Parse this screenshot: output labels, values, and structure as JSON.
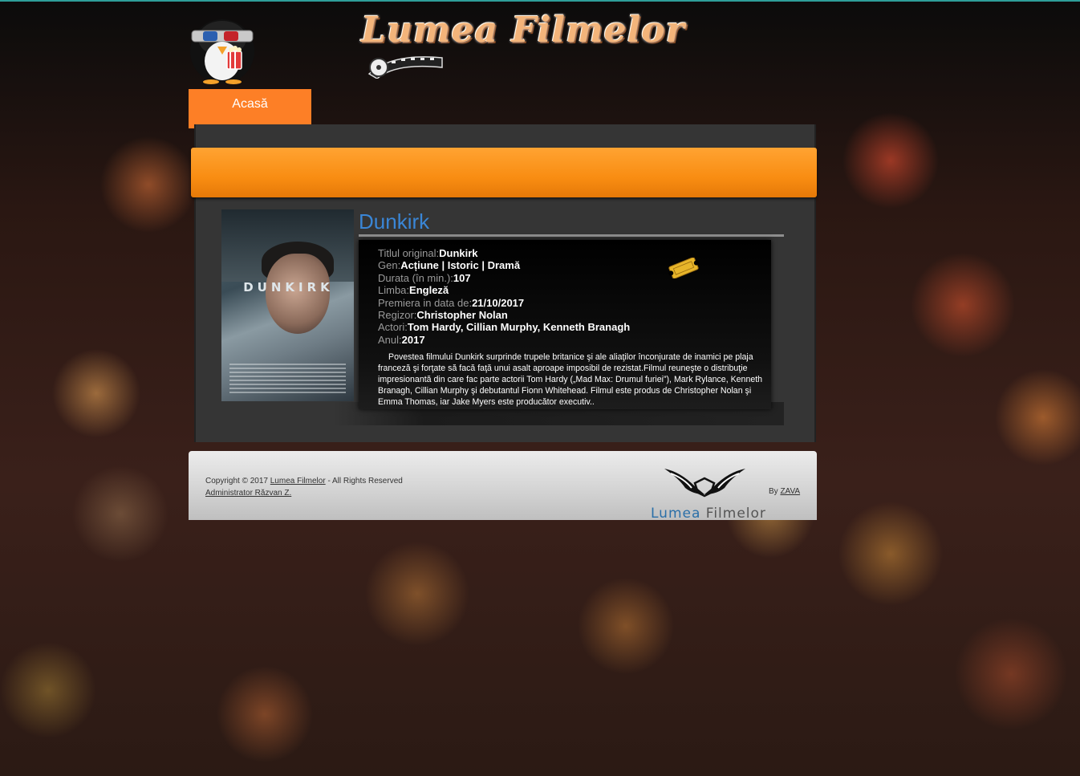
{
  "header": {
    "site_title": "Lumea Filmelor",
    "mascot_icon": "penguin-3d-glasses-icon"
  },
  "nav": {
    "home_label": "Acasă"
  },
  "colors": {
    "accent_orange": "#fd7f26",
    "banner_orange": "#f98d12",
    "title_blue": "#3a86d6",
    "panel_dark": "#353535"
  },
  "movie": {
    "title": "Dunkirk",
    "poster_title": "DUNKIRK",
    "fields": [
      {
        "label": "Titlul original:",
        "value": "Dunkirk"
      },
      {
        "label": "Gen:",
        "value": "Acțiune | Istoric | Dramă"
      },
      {
        "label": "Durata (în min.):",
        "value": "107"
      },
      {
        "label": "Limba:",
        "value": "Engleză"
      },
      {
        "label": "Premiera in data de:",
        "value": "21/10/2017"
      },
      {
        "label": "Regizor:",
        "value": "Christopher Nolan"
      },
      {
        "label": "Actori:",
        "value": "Tom Hardy, Cillian Murphy, Kenneth Branagh"
      },
      {
        "label": "Anul:",
        "value": "2017"
      }
    ],
    "ticket_icon": "cinema-ticket-icon",
    "description": "Povestea filmului Dunkirk surprinde trupele britanice şi ale aliaţilor înconjurate de inamici pe plaja franceză şi forţate să facă faţă unui asalt aproape imposibil de rezistat.Filmul reuneşte o distribuţie impresionantă din care fac parte actorii Tom Hardy („Mad Max: Drumul furiei”), Mark Rylance, Kenneth Branagh, Cillian Murphy şi debutantul Fionn Whitehead. Filmul este produs de Christopher Nolan şi Emma Thomas, iar Jake Myers este producător executiv.."
  },
  "footer": {
    "copyright_prefix": "Copyright © 2017 ",
    "copyright_link": "Lumea Filmelor",
    "copyright_suffix": " - All Rights Reserved",
    "admin_link": "Administrator Răzvan Z.",
    "by_prefix": "By ",
    "by_link": "ZAVA",
    "logo_text_1": "Lumea",
    "logo_text_2": "Filmelor",
    "logo_icon": "wings-mask-icon"
  }
}
